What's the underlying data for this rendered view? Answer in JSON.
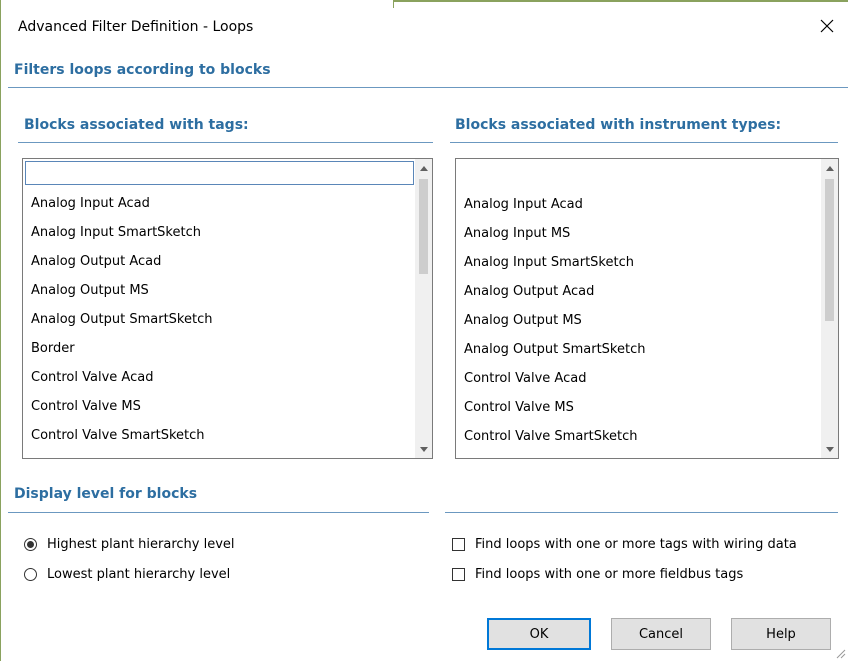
{
  "dialog": {
    "title": "Advanced Filter Definition - Loops",
    "close_icon": "close-icon"
  },
  "sections": {
    "blocks_heading": "Filters loops according to blocks",
    "tags_heading": "Blocks associated with tags:",
    "instrument_heading": "Blocks associated with instrument types:",
    "display_level_heading": "Display level for blocks"
  },
  "tags_list": {
    "edit_value": "",
    "items": [
      "Analog Input Acad",
      "Analog Input SmartSketch",
      "Analog Output Acad",
      "Analog Output MS",
      "Analog Output SmartSketch",
      "Border",
      "Control Valve Acad",
      "Control Valve MS",
      "Control Valve SmartSketch"
    ]
  },
  "instrument_list": {
    "items": [
      "Analog Input Acad",
      "Analog Input MS",
      "Analog Input SmartSketch",
      "Analog Output Acad",
      "Analog Output MS",
      "Analog Output SmartSketch",
      "Control Valve Acad",
      "Control Valve MS",
      "Control Valve SmartSketch"
    ]
  },
  "display_level": {
    "options": [
      {
        "label": "Highest plant hierarchy level",
        "selected": true
      },
      {
        "label": "Lowest plant hierarchy level",
        "selected": false
      }
    ]
  },
  "options": {
    "wiring_label": "Find loops with one or more tags with wiring data",
    "wiring_checked": false,
    "fieldbus_label": "Find loops with one or more fieldbus tags",
    "fieldbus_checked": false
  },
  "buttons": {
    "ok": "OK",
    "cancel": "Cancel",
    "help": "Help"
  },
  "colors": {
    "heading": "#2d6ea1",
    "rule": "#6b98c0",
    "default_button_border": "#0078d7",
    "window_accent": "#8aa25e"
  }
}
